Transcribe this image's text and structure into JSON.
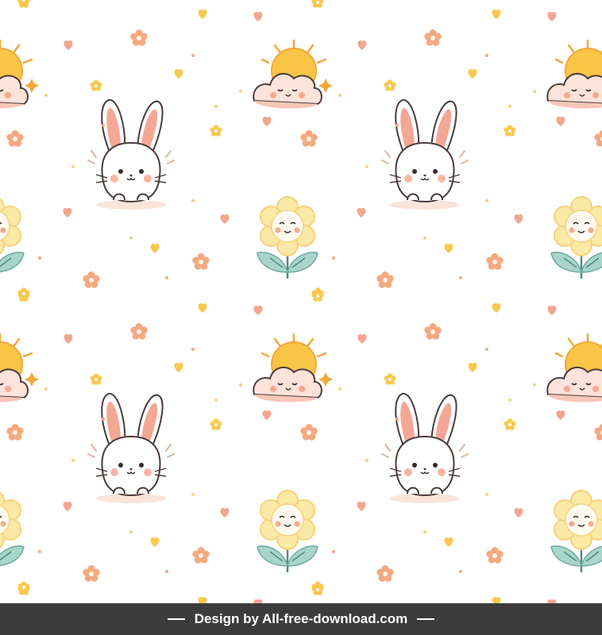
{
  "footer": {
    "credit": "Design by All-free-download.com"
  },
  "motifs": [
    "bunny",
    "flower",
    "sun-cloud",
    "small-blossom",
    "heart",
    "dot"
  ],
  "colors": {
    "background": "#ffffff",
    "bunny_outline": "#4a3b3b",
    "bunny_ear_inner": "#f5a796",
    "cheek": "#f7a98f",
    "petal_yellow": "#fbe9a6",
    "petal_orange": "#f6d27a",
    "leaf_teal": "#a9d4c9",
    "stem": "#4e8c82",
    "sun": "#f8c547",
    "cloud": "#fde3da",
    "blossom": "#f5a980",
    "heart_yellow": "#f9c94f",
    "heart_pink": "#f2a690",
    "footer_bg": "#3c3c3c",
    "footer_text": "#ffffff"
  }
}
